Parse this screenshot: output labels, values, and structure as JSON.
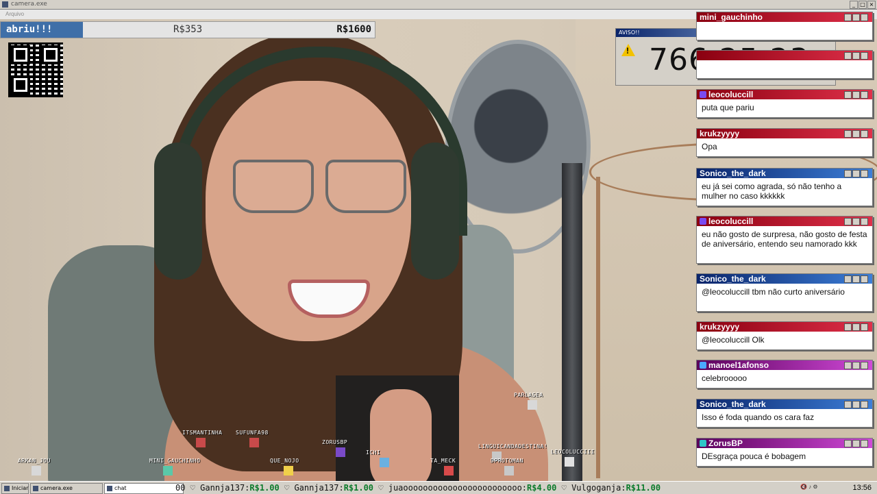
{
  "window": {
    "title": "camera.exe",
    "menu": "Arquivo",
    "buttons": [
      "_",
      "□",
      "×"
    ]
  },
  "goal": {
    "label": "abriu!!!",
    "current": "R$353",
    "target": "R$1600",
    "progress": 0.22
  },
  "qr": {
    "icon": "qr-code-icon"
  },
  "timer": {
    "title": "AVISO!!",
    "time": "766:25:23",
    "icon": "warning-icon"
  },
  "chat": {
    "messages": [
      {
        "user": "mini_gauchinho",
        "text": "",
        "color": "red"
      },
      {
        "user": "",
        "text": "",
        "color": "red"
      },
      {
        "user": "leocoluccill",
        "text": "puta que pariu",
        "color": "red",
        "badge": "mod-icon"
      },
      {
        "user": "krukzyyyy",
        "text": "Opa",
        "color": "red"
      },
      {
        "user": "Sonico_the_dark",
        "text": "eu já sei como agrada, só não tenho a mulher no caso kkkkkk",
        "color": "blue"
      },
      {
        "user": "leocoluccill",
        "text": "eu não gosto de surpresa, não gosto de festa de aniversário, entendo seu namorado kkk",
        "color": "red",
        "badge": "mod-icon"
      },
      {
        "user": "Sonico_the_dark",
        "text": "@leocoluccill tbm não curto aniversário",
        "color": "blue"
      },
      {
        "user": "krukzyyyy",
        "text": "@leocoluccill Olk",
        "color": "red"
      },
      {
        "user": "manoel1afonso",
        "text": "celebrooooo",
        "color": "purple",
        "badge": "crown-icon"
      },
      {
        "user": "Sonico_the_dark",
        "text": "Isso é foda quando os cara faz",
        "color": "blue"
      },
      {
        "user": "ZorusBP",
        "text": "DEsgraça pouca é bobagem",
        "color": "purple",
        "badge": "sub-icon"
      }
    ]
  },
  "avatars": [
    {
      "name": "ITSMANTINHA"
    },
    {
      "name": "SUFUNFA98"
    },
    {
      "name": "ZORUSBP"
    },
    {
      "name": "PARLASEA"
    },
    {
      "name": "ARKAN_JOU"
    },
    {
      "name": "MINI_GAUCHINHO"
    },
    {
      "name": "QUE_NOJO"
    },
    {
      "name": "ICHI"
    },
    {
      "name": "TA_MECK"
    },
    {
      "name": "LINGUICANDADESTINA!"
    },
    {
      "name": "DPROTOMAN"
    },
    {
      "name": "LEOCOLUCCIII"
    }
  ],
  "taskbar": {
    "start": "Iniciar",
    "tabs": [
      "camera.exe",
      "chat"
    ],
    "ticker": [
      {
        "prefix": "00",
        "name": "",
        "amount": ""
      },
      {
        "name": "Gannja137:",
        "amount": "R$1.00"
      },
      {
        "name": "Gannja137:",
        "amount": "R$1.00"
      },
      {
        "name": "juaoooooooooooooooooooooooo:",
        "amount": "R$4.00"
      },
      {
        "name": "Vulgoganja:",
        "amount": "R$11.00"
      }
    ],
    "clock": "13:56"
  }
}
